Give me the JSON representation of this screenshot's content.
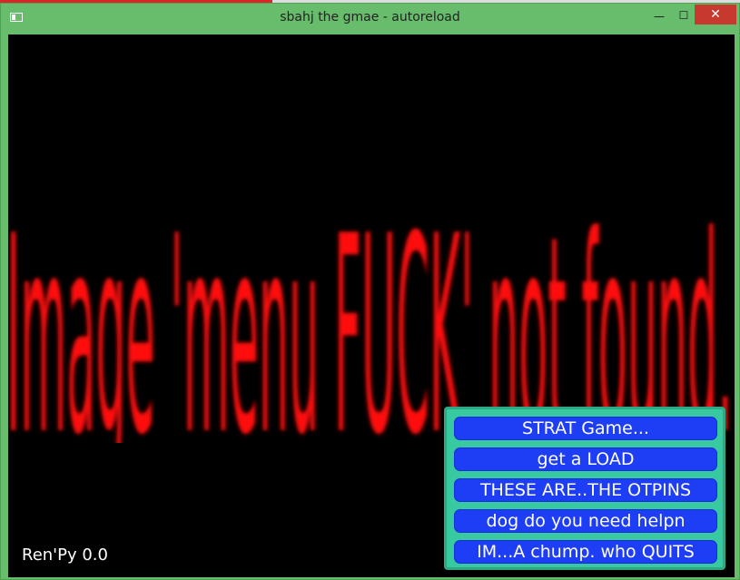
{
  "window": {
    "title": "sbahj the gmae - autoreload",
    "minimize_glyph": "—",
    "maximize_glyph": "☐",
    "close_glyph": "✕"
  },
  "game": {
    "missing_image_text": "Image 'menu FUCK' not found.",
    "engine_label": "Ren'Py 0.0"
  },
  "menu": {
    "items": [
      {
        "label": "STRAT Game..."
      },
      {
        "label": "get a LOAD"
      },
      {
        "label": "THESE ARE..THE OTPINS"
      },
      {
        "label": "dog do you need helpn"
      },
      {
        "label": "IM...A chump. who QUITS"
      }
    ]
  },
  "colors": {
    "window_frame": "#67bd6c",
    "close_button": "#c7392e",
    "error_text": "#ff0000",
    "menu_frame": "#38c9a0",
    "menu_button": "#1d3ef5",
    "background": "#000000"
  }
}
